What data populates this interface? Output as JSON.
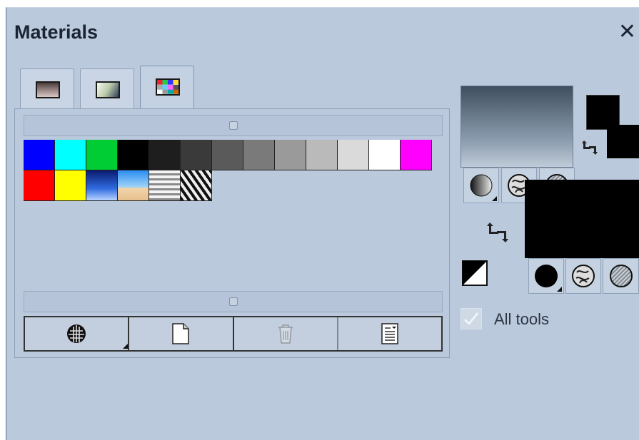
{
  "panel": {
    "title": "Materials",
    "close_glyph": "✕"
  },
  "tabs": [
    {
      "name": "gradient-tab",
      "icon": "dark-gradient-icon"
    },
    {
      "name": "texture-tab",
      "icon": "light-gradient-icon"
    },
    {
      "name": "swatches-tab",
      "icon": "color-grid-icon",
      "active": true
    }
  ],
  "swatches": {
    "row1": [
      "#0000ff",
      "#00ffff",
      "#00cc33",
      "#000000",
      "#1e1e1e",
      "#3a3a3a",
      "#5a5a5a",
      "#7a7a7a",
      "#9a9a9a",
      "#bababa",
      "#dadada",
      "#ffffff",
      "#ff00ff"
    ],
    "row2": [
      "#ff0000",
      "#ffff00",
      "blue-gradient",
      "sky-sand-gradient",
      "stripes-pattern",
      "zebra-pattern"
    ]
  },
  "toolbar": {
    "buttons": [
      {
        "name": "material-type-button",
        "icon": "globe-grid-icon"
      },
      {
        "name": "new-swatch-button",
        "icon": "new-document-icon"
      },
      {
        "name": "delete-swatch-button",
        "icon": "trash-icon",
        "disabled": true
      },
      {
        "name": "swatch-options-button",
        "icon": "list-document-icon"
      }
    ]
  },
  "right_panel": {
    "foreground_style_buttons": [
      "solid-circle-icon",
      "pattern-icon",
      "texture-icon"
    ],
    "background_style_buttons": [
      "solid-circle-icon",
      "pattern-icon",
      "texture-icon"
    ],
    "swap_glyph": "⮌",
    "all_tools_label": "All tools",
    "all_tools_checked": true
  }
}
